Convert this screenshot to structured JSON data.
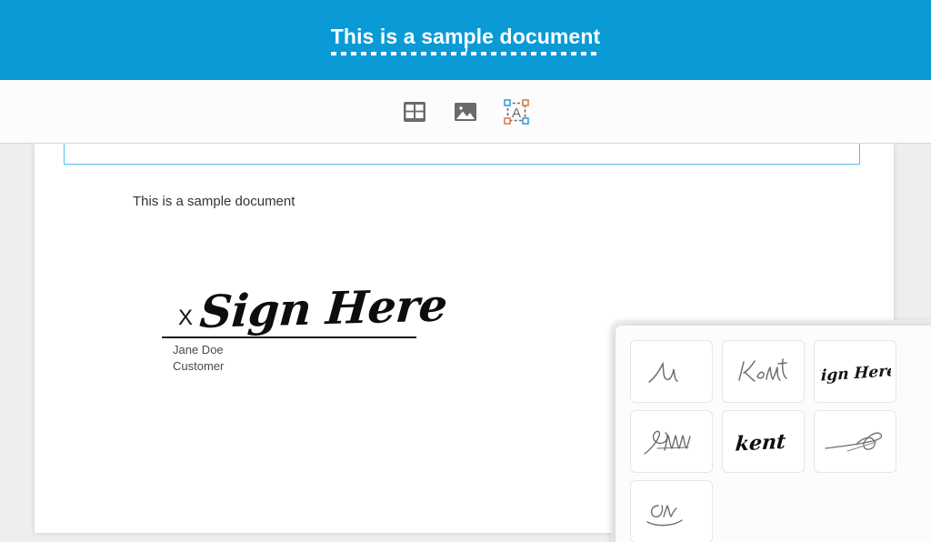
{
  "header": {
    "document_title": "This is a sample document",
    "background_color": "#0a9bd7",
    "title_color": "#ffffff"
  },
  "toolbar": {
    "tools": [
      {
        "name": "insert-table",
        "icon": "table-icon",
        "label": "Table"
      },
      {
        "name": "insert-image",
        "icon": "image-icon",
        "label": "Image"
      },
      {
        "name": "insert-textbox",
        "icon": "textbox-icon",
        "label": "Text Box"
      }
    ]
  },
  "document": {
    "text_field_value": "",
    "body_text": "This is a sample document",
    "signature": {
      "x_marker": "X",
      "signature_text": "Sign Here",
      "signer_name": "Jane Doe",
      "signer_role": "Customer"
    }
  },
  "signature_picker": {
    "items": [
      {
        "id": "sig-1",
        "label": "u",
        "style": "thin-script"
      },
      {
        "id": "sig-2",
        "label": "Kent",
        "style": "thin-script"
      },
      {
        "id": "sig-3",
        "label": "Sign Here",
        "style": "bold-brush"
      },
      {
        "id": "sig-4",
        "label": "Jmm",
        "style": "scribble"
      },
      {
        "id": "sig-5",
        "label": "kent",
        "style": "bold-brush"
      },
      {
        "id": "sig-6",
        "label": "flourish",
        "style": "loop-flourish"
      },
      {
        "id": "sig-7",
        "label": "Om",
        "style": "thin-script"
      }
    ]
  },
  "colors": {
    "accent": "#0a9bd7",
    "field_border": "#4fc2f0",
    "workspace": "#eeeeee",
    "page": "#ffffff"
  }
}
